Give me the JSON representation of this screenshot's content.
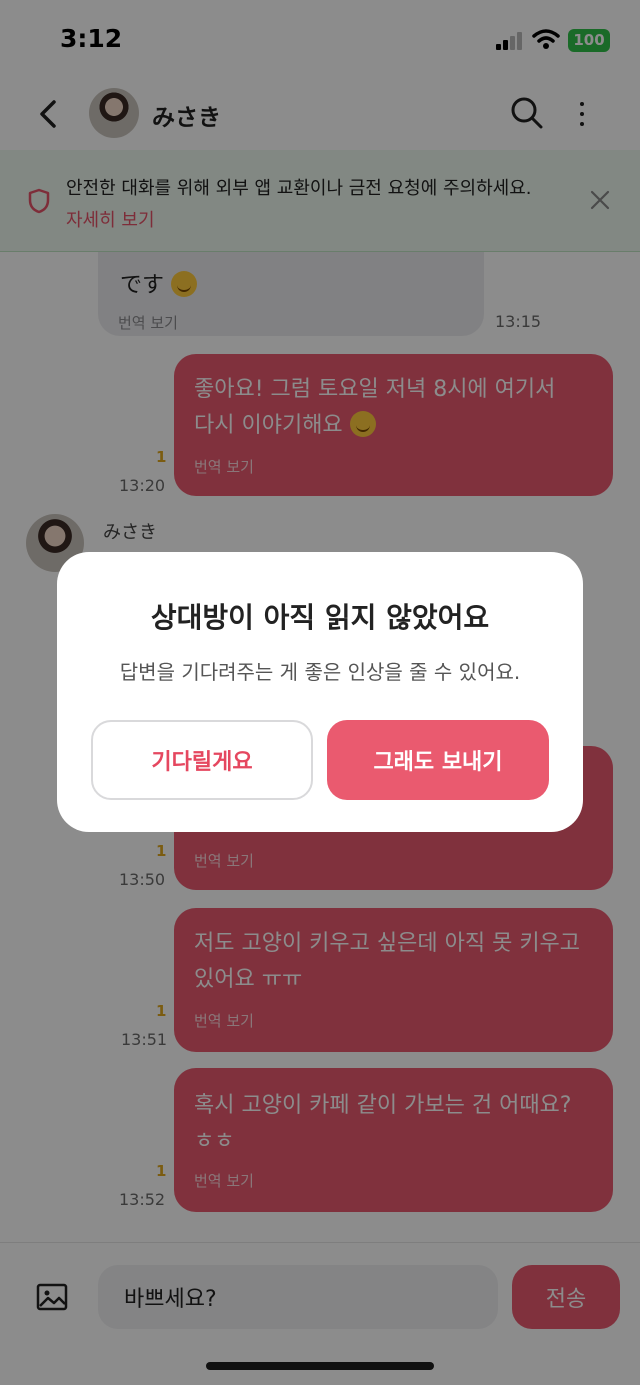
{
  "status_bar": {
    "time": "3:12",
    "battery": "100"
  },
  "header": {
    "name": "みさき"
  },
  "banner": {
    "text": "안전한 대화를 위해 외부 앱 교환이나 금전 요청에 주의하세요.",
    "link": "자세히 보기"
  },
  "messages": [
    {
      "direction": "in",
      "lines": [
        "です"
      ],
      "translate": "번역 보기",
      "time": "13:15"
    },
    {
      "direction": "out",
      "lines": [
        "좋아요! 그럼 토요일 저녁 8시에 여기서",
        "다시 이야기해요"
      ],
      "translate": "번역 보기",
      "time": "13:20",
      "read": "1"
    },
    {
      "direction": "in",
      "sender": "みさき"
    },
    {
      "direction": "out",
      "lines": [],
      "translate": "번역 보기",
      "time": "13:50",
      "read": "1"
    },
    {
      "direction": "out",
      "lines": [
        "저도 고양이 키우고 싶은데 아직 못 키우고",
        "있어요 ㅠㅠ"
      ],
      "translate": "번역 보기",
      "time": "13:51",
      "read": "1"
    },
    {
      "direction": "out",
      "lines": [
        "혹시 고양이 카페 같이 가보는 건 어때요?",
        "ㅎㅎ"
      ],
      "translate": "번역 보기",
      "time": "13:52",
      "read": "1"
    }
  ],
  "input": {
    "value": "바쁘세요?",
    "send_label": "전송"
  },
  "dialog": {
    "title": "상대방이 아직 읽지 않았어요",
    "description": "답변을 기다려주는 게 좋은 인상을 줄 수 있어요.",
    "wait_label": "기다릴게요",
    "send_anyway_label": "그래도 보내기"
  },
  "colors": {
    "accent": "#ea5a6f",
    "banner_bg": "#edf7ee",
    "read_badge": "#e0a820"
  }
}
